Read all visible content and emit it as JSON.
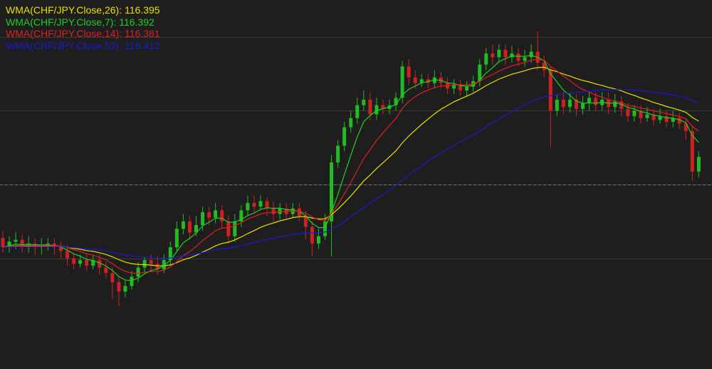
{
  "chart_data": {
    "type": "candlestick",
    "title": "",
    "xlabel": "",
    "ylabel": "",
    "ylim": [
      115.5,
      117.5
    ],
    "gridlines_y": [
      117.3,
      116.9,
      116.5,
      116.1
    ],
    "reference_line": 116.5,
    "colors": {
      "background": "#1e1e1e",
      "up": "#22bb22",
      "down": "#cc2222",
      "grid": "#3a3a3a",
      "reference": "#777777"
    },
    "legend_position": "top-left",
    "series": [
      {
        "name": "WMA(CHF/JPY.Close,26)",
        "value_label": "116.395",
        "color": "#e8e000"
      },
      {
        "name": "WMA(CHF/JPY.Close,7)",
        "value_label": "116.392",
        "color": "#22cc22"
      },
      {
        "name": "WMA(CHF/JPY.Close,14)",
        "value_label": "116.381",
        "color": "#dd2020"
      },
      {
        "name": "WMA(CHF/JPY.Close,52)",
        "value_label": "116.412",
        "color": "#1a1ad0"
      }
    ],
    "candles": [
      [
        116.21,
        116.16,
        116.25,
        116.13
      ],
      [
        116.16,
        116.19,
        116.22,
        116.13
      ],
      [
        116.19,
        116.2,
        116.24,
        116.15
      ],
      [
        116.2,
        116.16,
        116.23,
        116.13
      ],
      [
        116.16,
        116.18,
        116.22,
        116.13
      ],
      [
        116.18,
        116.16,
        116.21,
        116.12
      ],
      [
        116.16,
        116.17,
        116.21,
        116.12
      ],
      [
        116.17,
        116.18,
        116.21,
        116.14
      ],
      [
        116.18,
        116.16,
        116.21,
        116.12
      ],
      [
        116.16,
        116.14,
        116.19,
        116.1
      ],
      [
        116.14,
        116.1,
        116.17,
        116.06
      ],
      [
        116.1,
        116.07,
        116.13,
        116.04
      ],
      [
        116.07,
        116.09,
        116.12,
        116.05
      ],
      [
        116.09,
        116.06,
        116.12,
        116.03
      ],
      [
        116.06,
        116.09,
        116.12,
        116.04
      ],
      [
        116.09,
        116.05,
        116.12,
        116.01
      ],
      [
        116.05,
        116.02,
        116.08,
        115.99
      ],
      [
        116.02,
        115.97,
        116.05,
        115.88
      ],
      [
        115.97,
        115.92,
        116.0,
        115.84
      ],
      [
        115.92,
        115.95,
        115.98,
        115.89
      ],
      [
        115.95,
        116.0,
        116.03,
        115.93
      ],
      [
        116.0,
        116.05,
        116.08,
        115.97
      ],
      [
        116.05,
        116.09,
        116.11,
        116.02
      ],
      [
        116.09,
        116.07,
        116.12,
        116.03
      ],
      [
        116.07,
        116.04,
        116.11,
        116.01
      ],
      [
        116.04,
        116.09,
        116.12,
        116.02
      ],
      [
        116.09,
        116.16,
        116.19,
        116.06
      ],
      [
        116.16,
        116.26,
        116.3,
        116.14
      ],
      [
        116.26,
        116.3,
        116.34,
        116.23
      ],
      [
        116.3,
        116.24,
        116.33,
        116.2
      ],
      [
        116.24,
        116.28,
        116.33,
        116.22
      ],
      [
        116.28,
        116.35,
        116.38,
        116.25
      ],
      [
        116.35,
        116.32,
        116.38,
        116.28
      ],
      [
        116.32,
        116.36,
        116.4,
        116.29
      ],
      [
        116.36,
        116.3,
        116.39,
        116.26
      ],
      [
        116.3,
        116.22,
        116.33,
        116.18
      ],
      [
        116.22,
        116.3,
        116.34,
        116.19
      ],
      [
        116.3,
        116.36,
        116.39,
        116.27
      ],
      [
        116.36,
        116.4,
        116.44,
        116.33
      ],
      [
        116.4,
        116.38,
        116.44,
        116.35
      ],
      [
        116.38,
        116.41,
        116.44,
        116.36
      ],
      [
        116.41,
        116.37,
        116.43,
        116.33
      ],
      [
        116.37,
        116.34,
        116.41,
        116.3
      ],
      [
        116.34,
        116.37,
        116.4,
        116.31
      ],
      [
        116.37,
        116.34,
        116.4,
        116.31
      ],
      [
        116.34,
        116.37,
        116.4,
        116.32
      ],
      [
        116.37,
        116.33,
        116.4,
        116.3
      ],
      [
        116.33,
        116.27,
        116.36,
        116.2
      ],
      [
        116.27,
        116.18,
        116.3,
        116.11
      ],
      [
        116.18,
        116.22,
        116.26,
        116.15
      ],
      [
        116.22,
        116.3,
        116.34,
        116.2
      ],
      [
        116.3,
        116.62,
        116.66,
        116.11
      ],
      [
        116.62,
        116.71,
        116.74,
        116.59
      ],
      [
        116.71,
        116.81,
        116.84,
        116.68
      ],
      [
        116.81,
        116.86,
        116.9,
        116.78
      ],
      [
        116.86,
        116.93,
        116.97,
        116.83
      ],
      [
        116.93,
        116.96,
        117.01,
        116.9
      ],
      [
        116.96,
        116.88,
        117.0,
        116.85
      ],
      [
        116.88,
        116.93,
        116.97,
        116.85
      ],
      [
        116.93,
        116.91,
        116.96,
        116.88
      ],
      [
        116.91,
        116.93,
        116.96,
        116.88
      ],
      [
        116.93,
        116.97,
        117.0,
        116.9
      ],
      [
        116.97,
        117.14,
        117.17,
        116.94
      ],
      [
        117.14,
        117.08,
        117.18,
        117.04
      ],
      [
        117.08,
        117.05,
        117.12,
        117.02
      ],
      [
        117.05,
        117.07,
        117.1,
        117.03
      ],
      [
        117.07,
        117.05,
        117.1,
        117.02
      ],
      [
        117.05,
        117.08,
        117.12,
        117.02
      ],
      [
        117.08,
        117.05,
        117.11,
        117.02
      ],
      [
        117.05,
        117.02,
        117.08,
        116.99
      ],
      [
        117.02,
        117.04,
        117.07,
        116.99
      ],
      [
        117.04,
        117.01,
        117.07,
        116.98
      ],
      [
        117.01,
        117.03,
        117.06,
        116.98
      ],
      [
        117.03,
        117.06,
        117.09,
        117.0
      ],
      [
        117.06,
        117.15,
        117.18,
        117.03
      ],
      [
        117.15,
        117.21,
        117.24,
        117.12
      ],
      [
        117.21,
        117.19,
        117.26,
        117.15
      ],
      [
        117.19,
        117.23,
        117.26,
        117.16
      ],
      [
        117.23,
        117.19,
        117.26,
        117.15
      ],
      [
        117.19,
        117.21,
        117.25,
        117.16
      ],
      [
        117.21,
        117.17,
        117.24,
        117.14
      ],
      [
        117.17,
        117.19,
        117.23,
        117.14
      ],
      [
        117.19,
        117.22,
        117.26,
        117.16
      ],
      [
        117.22,
        117.16,
        117.33,
        117.12
      ],
      [
        117.16,
        117.12,
        117.2,
        117.08
      ],
      [
        117.12,
        116.9,
        117.14,
        116.7
      ],
      [
        116.9,
        116.96,
        116.99,
        116.87
      ],
      [
        116.96,
        116.92,
        117.0,
        116.88
      ],
      [
        116.92,
        116.96,
        117.0,
        116.89
      ],
      [
        116.96,
        116.91,
        116.99,
        116.87
      ],
      [
        116.91,
        116.94,
        116.98,
        116.88
      ],
      [
        116.94,
        116.97,
        117.0,
        116.9
      ],
      [
        116.97,
        116.93,
        117.0,
        116.9
      ],
      [
        116.93,
        116.96,
        117.0,
        116.9
      ],
      [
        116.96,
        116.92,
        117.0,
        116.88
      ],
      [
        116.92,
        116.95,
        116.99,
        116.89
      ],
      [
        116.95,
        116.91,
        116.98,
        116.87
      ],
      [
        116.91,
        116.87,
        116.94,
        116.84
      ],
      [
        116.87,
        116.9,
        116.93,
        116.84
      ],
      [
        116.9,
        116.86,
        116.93,
        116.83
      ],
      [
        116.86,
        116.88,
        116.92,
        116.84
      ],
      [
        116.88,
        116.85,
        116.91,
        116.82
      ],
      [
        116.85,
        116.87,
        116.91,
        116.83
      ],
      [
        116.87,
        116.84,
        116.9,
        116.81
      ],
      [
        116.84,
        116.86,
        116.9,
        116.81
      ],
      [
        116.86,
        116.83,
        116.89,
        116.8
      ],
      [
        116.83,
        116.79,
        116.86,
        116.74
      ],
      [
        116.79,
        116.57,
        116.82,
        116.52
      ],
      [
        116.57,
        116.65,
        116.68,
        116.54
      ]
    ]
  }
}
